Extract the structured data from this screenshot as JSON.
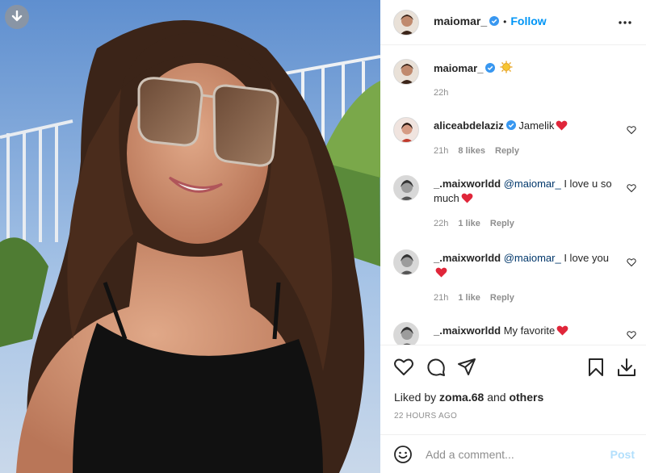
{
  "post": {
    "author": "maiomar_",
    "follow_label": "Follow",
    "dot": "•",
    "caption_time": "22h",
    "likes_prefix": "Liked by",
    "likes_user": "zoma.68",
    "likes_and": "and",
    "likes_others": "others",
    "timestamp": "22 HOURS AGO"
  },
  "comments": [
    {
      "user": "aliceabdelaziz",
      "verified": true,
      "mention": "",
      "text": "Jamelik",
      "emoji": "red-heart",
      "time": "21h",
      "likes": "8 likes",
      "reply": "Reply"
    },
    {
      "user": "_.maixworldd",
      "verified": false,
      "mention": "@maiomar_",
      "text": "I love u so much",
      "emoji": "red-heart",
      "time": "22h",
      "likes": "1 like",
      "reply": "Reply"
    },
    {
      "user": "_.maixworldd",
      "verified": false,
      "mention": "@maiomar_",
      "text": "I love you",
      "emoji": "red-heart",
      "time": "21h",
      "likes": "1 like",
      "reply": "Reply"
    },
    {
      "user": "_.maixworldd",
      "verified": false,
      "mention": "",
      "text": "My favorite",
      "emoji": "red-heart",
      "time": "",
      "likes": "",
      "reply": ""
    }
  ],
  "add_comment": {
    "placeholder": "Add a comment...",
    "post_label": "Post"
  },
  "icons": {
    "download": "download-arrow-icon",
    "more": "more-options-icon",
    "like": "heart-icon",
    "comment": "comment-bubble-icon",
    "share": "paper-plane-icon",
    "save": "bookmark-icon",
    "download_post": "download-icon",
    "emoji": "smiley-icon",
    "caption_emoji": "sun-emoji"
  },
  "colors": {
    "accent": "#0095f6",
    "verified": "#3897f0",
    "heart": "#ed4956",
    "post_disabled": "#b2dffc"
  }
}
